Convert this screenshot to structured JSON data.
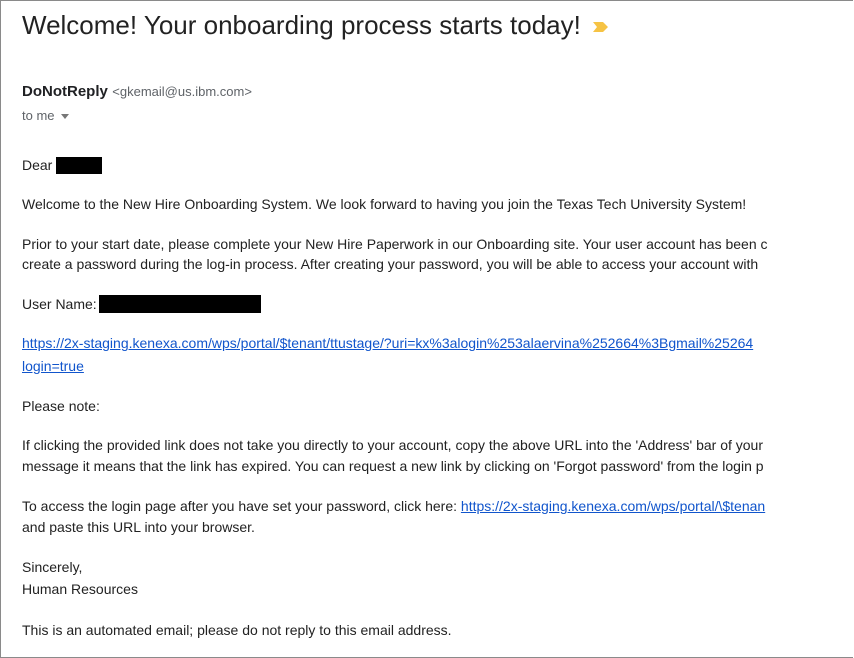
{
  "email": {
    "subject": "Welcome! Your onboarding process starts today!",
    "important_icon": "important-marker-icon",
    "sender": {
      "name": "DoNotReply",
      "email": "<gkemail@us.ibm.com>"
    },
    "to_label": "to me",
    "body": {
      "greeting": "Dear",
      "welcome": "Welcome to the New Hire Onboarding System. We look forward to having you join the Texas Tech University System!",
      "prior_line1": "Prior to your start date, please complete your New Hire Paperwork in our Onboarding site. Your user account has been c",
      "prior_line2": "create a password during the log-in process. After creating your password, you will be able to access your account with",
      "username_label": "User Name:",
      "login_link_line1": "https://2x-staging.kenexa.com/wps/portal/$tenant/ttustage/?uri=kx%3alogin%253alaervina%252664%3Bgmail%25264",
      "login_link_line2": "login=true",
      "please_note": "Please note:",
      "clicking_line1": "If clicking the provided link does not take you directly to your account, copy the above URL into the 'Address' bar of your",
      "clicking_line2": "message it means that the link has expired. You can request a new link by clicking on 'Forgot password' from the login p",
      "access_text": "To access the login page after you have set your password, click here: ",
      "access_link": "https://2x-staging.kenexa.com/wps/portal/\\$tenan",
      "access_line2": "and paste this URL into your browser.",
      "sincerely": "Sincerely,",
      "signature": "Human Resources",
      "automated": "This is an automated email; please do not reply to this email address."
    }
  },
  "colors": {
    "link": "#1155cc",
    "important_marker": "#f6c344",
    "redaction": "#000000"
  }
}
